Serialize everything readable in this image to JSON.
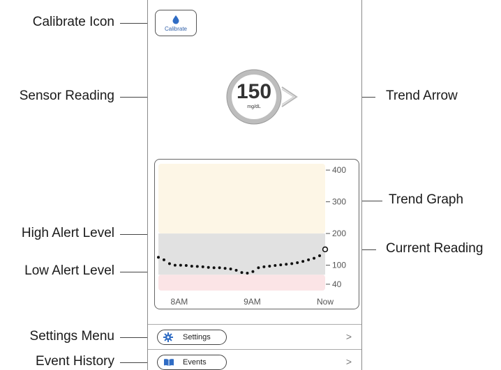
{
  "callouts": {
    "calibrate_icon": "Calibrate Icon",
    "sensor_reading": "Sensor Reading",
    "trend_arrow": "Trend Arrow",
    "trend_graph": "Trend Graph",
    "high_alert_level": "High Alert Level",
    "current_reading": "Current Reading",
    "low_alert_level": "Low Alert Level",
    "settings_menu": "Settings Menu",
    "event_history": "Event History"
  },
  "calibrate": {
    "label": "Calibrate",
    "icon": "blood-drop-icon"
  },
  "reading": {
    "value": "150",
    "unit": "mg/dL",
    "trend": "trend-arrow-right"
  },
  "menu": {
    "settings_label": "Settings",
    "events_label": "Events",
    "chevron": ">"
  },
  "colors": {
    "high_zone": "#fdf6e6",
    "target_zone": "#e1e1e1",
    "low_zone": "#fbe4e6",
    "accent": "#2f6cc4",
    "ring": "#b7b7b7"
  },
  "chart_data": {
    "type": "scatter",
    "x_tick_labels": [
      "8AM",
      "9AM",
      "Now"
    ],
    "y_ticks": [
      40,
      100,
      200,
      300,
      400
    ],
    "y_tick_labels": [
      "40",
      "100",
      "200",
      "300",
      "400"
    ],
    "high_alert": 200,
    "low_alert": 70,
    "ylim": [
      20,
      420
    ],
    "xlim": [
      0,
      240
    ],
    "x_ticks": [
      30,
      135,
      240
    ],
    "series": [
      {
        "values": [
          {
            "x": 0,
            "y": 125
          },
          {
            "x": 8,
            "y": 117
          },
          {
            "x": 16,
            "y": 105
          },
          {
            "x": 24,
            "y": 100
          },
          {
            "x": 32,
            "y": 100
          },
          {
            "x": 40,
            "y": 99
          },
          {
            "x": 48,
            "y": 97
          },
          {
            "x": 56,
            "y": 96
          },
          {
            "x": 64,
            "y": 95
          },
          {
            "x": 72,
            "y": 93
          },
          {
            "x": 80,
            "y": 92
          },
          {
            "x": 88,
            "y": 92
          },
          {
            "x": 96,
            "y": 90
          },
          {
            "x": 104,
            "y": 88
          },
          {
            "x": 112,
            "y": 84
          },
          {
            "x": 120,
            "y": 77
          },
          {
            "x": 128,
            "y": 75
          },
          {
            "x": 136,
            "y": 80
          },
          {
            "x": 144,
            "y": 92
          },
          {
            "x": 152,
            "y": 95
          },
          {
            "x": 160,
            "y": 97
          },
          {
            "x": 168,
            "y": 99
          },
          {
            "x": 176,
            "y": 101
          },
          {
            "x": 184,
            "y": 103
          },
          {
            "x": 192,
            "y": 105
          },
          {
            "x": 200,
            "y": 108
          },
          {
            "x": 208,
            "y": 112
          },
          {
            "x": 216,
            "y": 117
          },
          {
            "x": 224,
            "y": 122
          },
          {
            "x": 232,
            "y": 130
          }
        ]
      }
    ],
    "current": {
      "x": 240,
      "y": 150
    }
  }
}
